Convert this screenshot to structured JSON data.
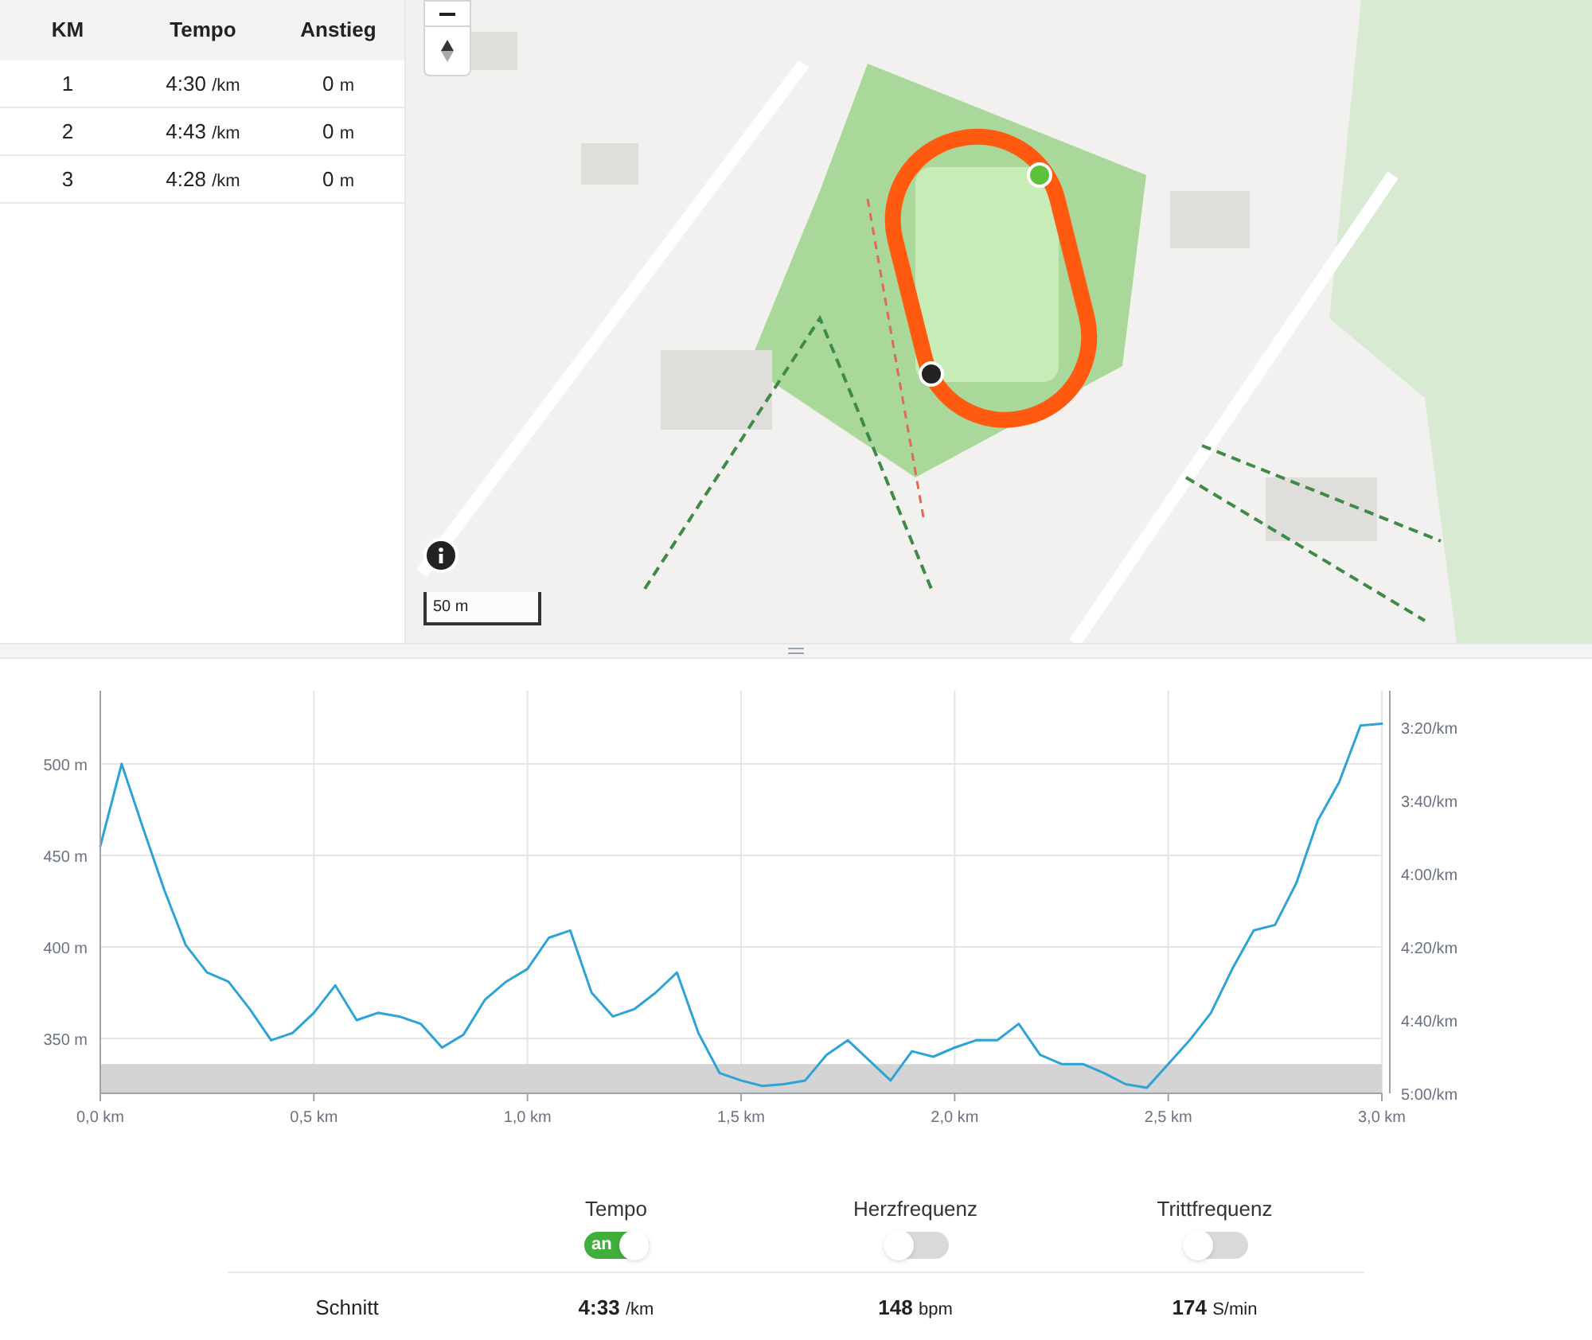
{
  "splits": {
    "columns": [
      "KM",
      "Tempo",
      "Anstieg"
    ],
    "rows": [
      {
        "km": "1",
        "tempo": "4:30",
        "tempo_unit": "/km",
        "climb": "0",
        "climb_unit": "m"
      },
      {
        "km": "2",
        "tempo": "4:43",
        "tempo_unit": "/km",
        "climb": "0",
        "climb_unit": "m"
      },
      {
        "km": "3",
        "tempo": "4:28",
        "tempo_unit": "/km",
        "climb": "0",
        "climb_unit": "m"
      }
    ]
  },
  "map": {
    "scale": "50 m"
  },
  "pace_axis_labels": [
    "3:20/km",
    "3:40/km",
    "4:00/km",
    "4:20/km",
    "4:40/km",
    "5:00/km"
  ],
  "chart_data": {
    "type": "line",
    "grid": true,
    "xlim": [
      0,
      3
    ],
    "ylim": [
      320,
      540
    ],
    "xticks": [
      {
        "value": 0,
        "label": "0,0 km"
      },
      {
        "value": 0.5,
        "label": "0,5 km"
      },
      {
        "value": 1,
        "label": "1,0 km"
      },
      {
        "value": 1.5,
        "label": "1,5 km"
      },
      {
        "value": 2,
        "label": "2,0 km"
      },
      {
        "value": 2.5,
        "label": "2,5 km"
      },
      {
        "value": 3,
        "label": "3,0 km"
      }
    ],
    "yticks": [
      {
        "value": 350,
        "label": "350 m"
      },
      {
        "value": 400,
        "label": "400 m"
      },
      {
        "value": 450,
        "label": "450 m"
      },
      {
        "value": 500,
        "label": "500 m"
      }
    ],
    "x": [
      0,
      0.05,
      0.1,
      0.15,
      0.2,
      0.25,
      0.3,
      0.35,
      0.4,
      0.45,
      0.5,
      0.55,
      0.6,
      0.65,
      0.7,
      0.75,
      0.8,
      0.85,
      0.9,
      0.95,
      1,
      1.05,
      1.1,
      1.15,
      1.2,
      1.25,
      1.3,
      1.35,
      1.4,
      1.45,
      1.5,
      1.55,
      1.6,
      1.65,
      1.7,
      1.75,
      1.8,
      1.85,
      1.9,
      1.95,
      2,
      2.05,
      2.1,
      2.15,
      2.2,
      2.25,
      2.3,
      2.35,
      2.4,
      2.45,
      2.5,
      2.55,
      2.6,
      2.65,
      2.7,
      2.75,
      2.8,
      2.85,
      2.9,
      2.95,
      3
    ],
    "series": [
      {
        "type": "area",
        "color": "#d4d4d4",
        "values": [
          336,
          336,
          336,
          336,
          336,
          336,
          336,
          336,
          336,
          336,
          336,
          336,
          336,
          336,
          336,
          336,
          336,
          336,
          336,
          336,
          336,
          336,
          336,
          336,
          336,
          336,
          336,
          336,
          336,
          336,
          336,
          336,
          336,
          336,
          336,
          336,
          336,
          336,
          336,
          336,
          336,
          336,
          336,
          336,
          336,
          336,
          336,
          336,
          336,
          336,
          336,
          336,
          336,
          336,
          336,
          336,
          336,
          336,
          336,
          336,
          336
        ]
      },
      {
        "type": "line",
        "color": "#2ea3d6",
        "values": [
          455,
          500,
          465,
          431,
          401,
          386,
          381,
          366,
          349,
          353,
          364,
          379,
          360,
          364,
          362,
          358,
          345,
          352,
          371,
          381,
          388,
          405,
          409,
          375,
          362,
          366,
          375,
          386,
          353,
          331,
          327,
          324,
          325,
          327,
          341,
          349,
          338,
          327,
          343,
          340,
          345,
          349,
          349,
          358,
          341,
          336,
          336,
          331,
          325,
          323,
          336,
          349,
          364,
          388,
          409,
          412,
          435,
          469,
          490,
          521,
          522
        ]
      }
    ]
  },
  "metrics": [
    {
      "label": "Tempo",
      "on": true,
      "on_label": "an"
    },
    {
      "label": "Herzfrequenz",
      "on": false
    },
    {
      "label": "Trittfrequenz",
      "on": false
    }
  ],
  "averages": {
    "label": "Schnitt",
    "values": [
      {
        "value": "4:33",
        "unit": "/km"
      },
      {
        "value": "148",
        "unit": "bpm"
      },
      {
        "value": "174",
        "unit": "S/min"
      }
    ]
  }
}
